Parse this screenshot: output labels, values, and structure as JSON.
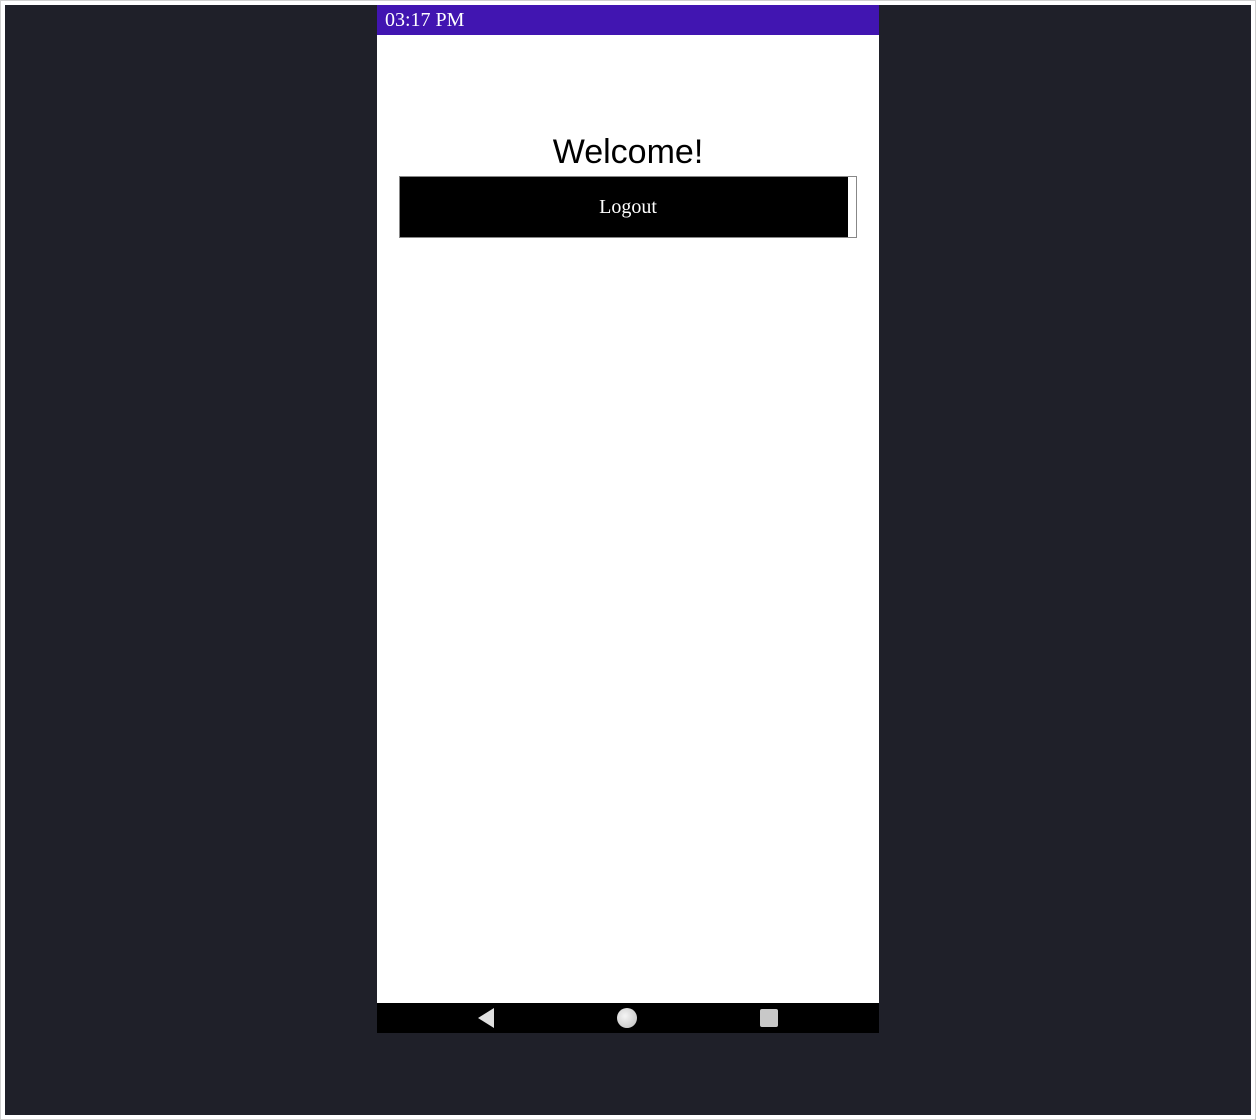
{
  "statusBar": {
    "time": "03:17 PM"
  },
  "main": {
    "title": "Welcome!",
    "logoutLabel": "Logout"
  },
  "colors": {
    "statusBarBg": "#4115b1",
    "darkSurround": "#1f2029",
    "buttonBg": "#000000"
  }
}
